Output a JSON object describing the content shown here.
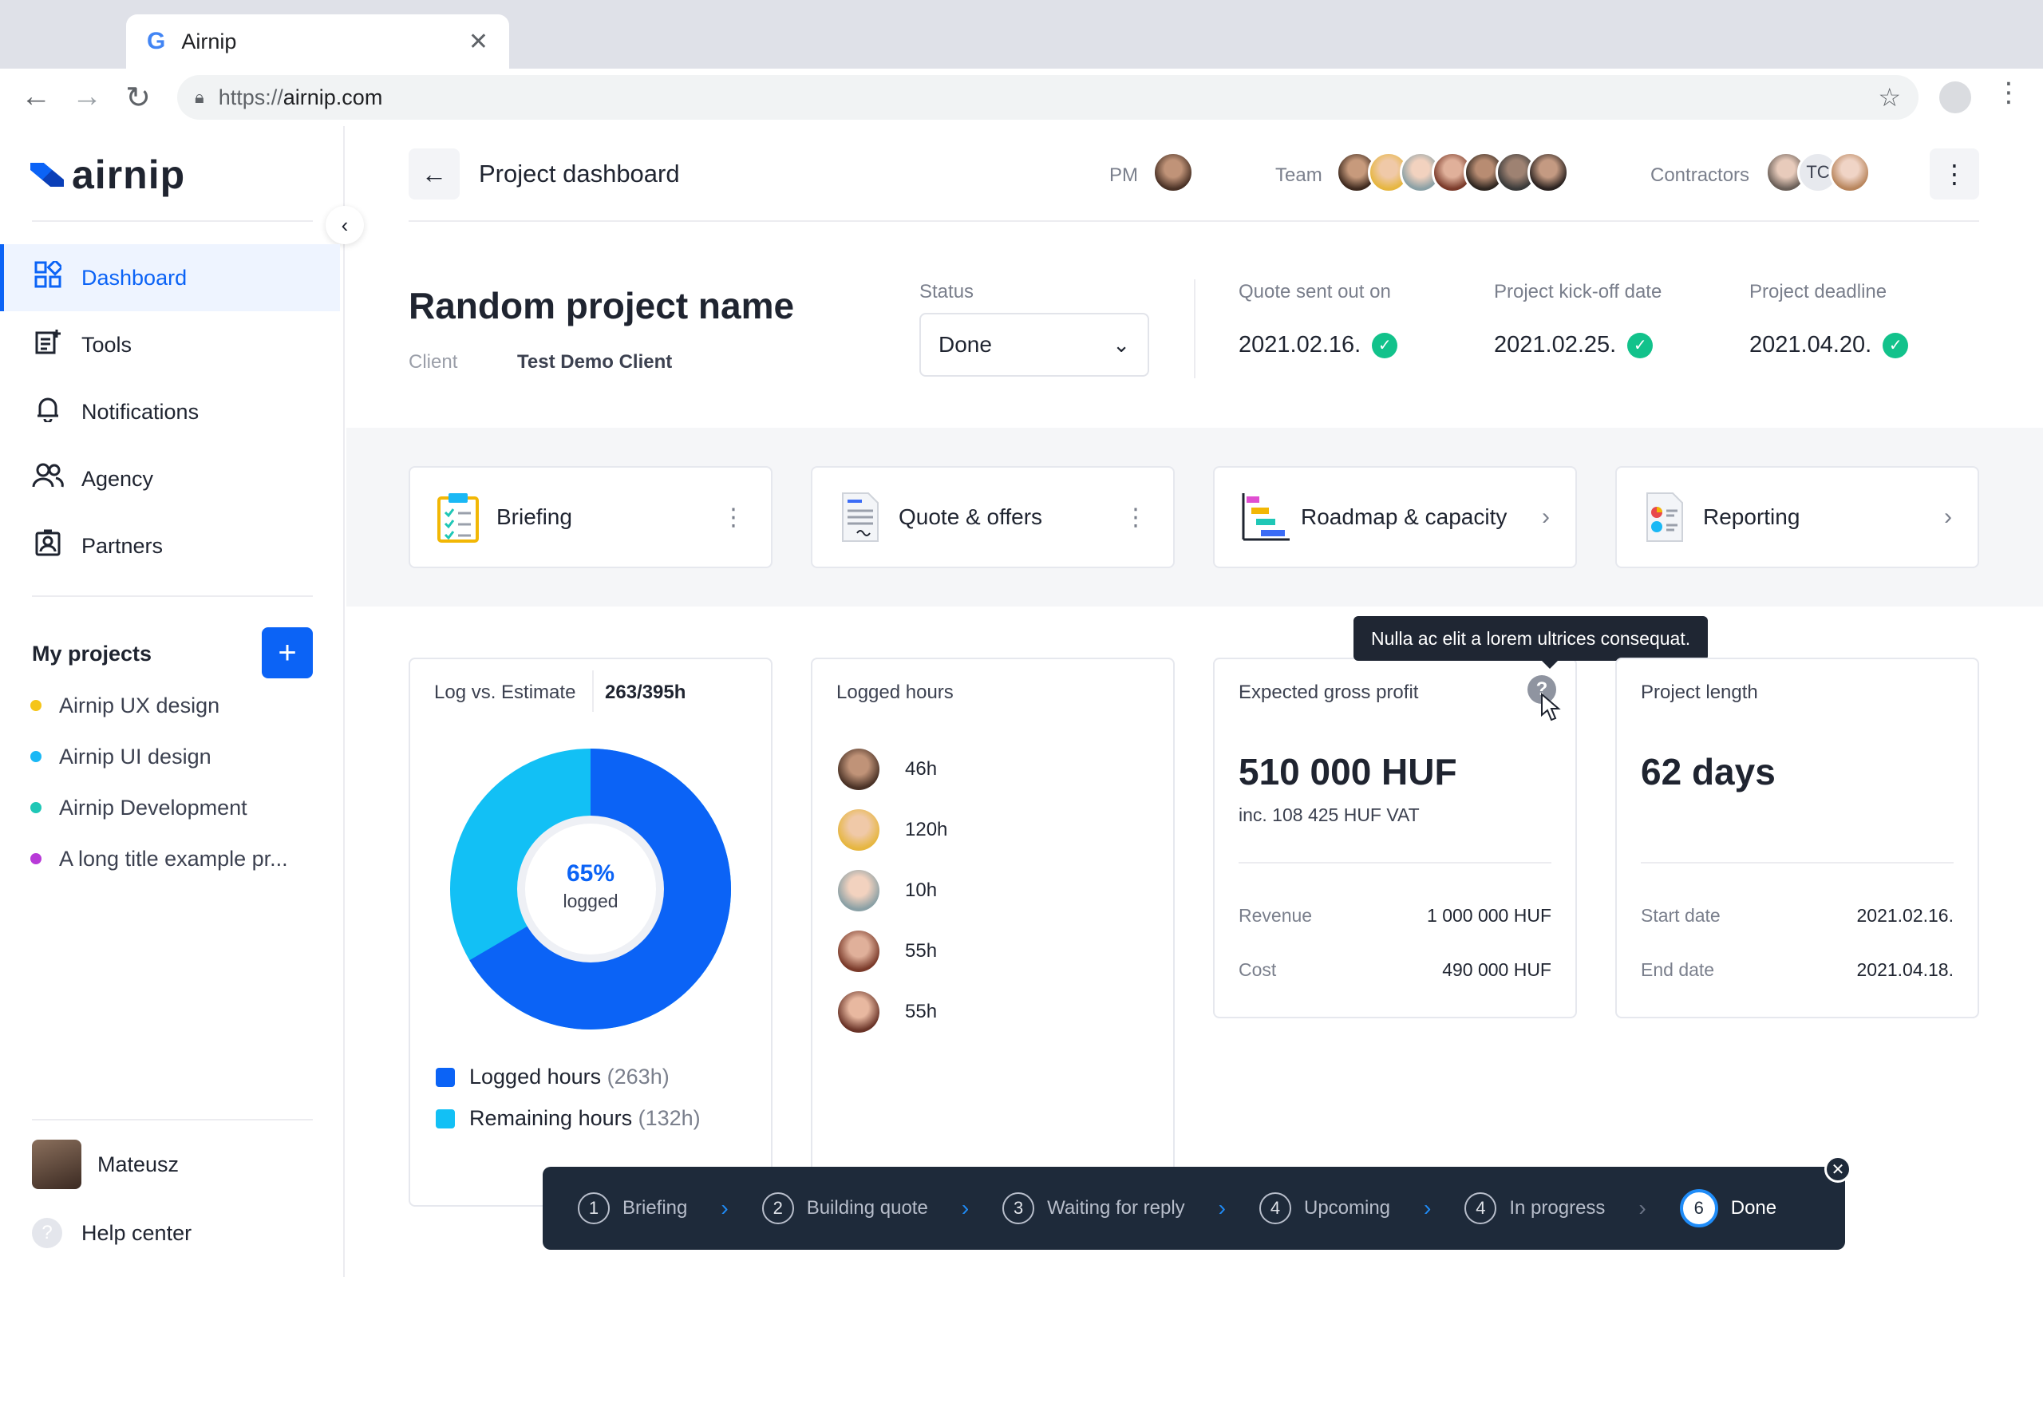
{
  "browser": {
    "tab_title": "Airnip",
    "tab_icon": "G",
    "url_scheme": "https://",
    "url_host": "airnip.com"
  },
  "sidebar": {
    "logo": "airnip",
    "items": [
      {
        "label": "Dashboard",
        "icon": "grid-icon"
      },
      {
        "label": "Tools",
        "icon": "tools-icon"
      },
      {
        "label": "Notifications",
        "icon": "bell-icon"
      },
      {
        "label": "Agency",
        "icon": "people-icon"
      },
      {
        "label": "Partners",
        "icon": "badge-icon"
      }
    ],
    "my_projects_label": "My projects",
    "projects": [
      {
        "name": "Airnip UX design",
        "color": "#f5c518"
      },
      {
        "name": "Airnip UI design",
        "color": "#1ab8f5"
      },
      {
        "name": "Airnip Development",
        "color": "#1fc7b6"
      },
      {
        "name": "A long title example pr...",
        "color": "#b83ad8"
      }
    ],
    "user_name": "Mateusz",
    "help_label": "Help center"
  },
  "header": {
    "title": "Project dashboard",
    "pm_label": "PM",
    "team_label": "Team",
    "contractors_label": "Contractors",
    "contractor_initials": "TC"
  },
  "project": {
    "name": "Random project name",
    "client_label": "Client",
    "client_value": "Test Demo Client",
    "status_label": "Status",
    "status_value": "Done",
    "dates": [
      {
        "label": "Quote sent out on",
        "value": "2021.02.16."
      },
      {
        "label": "Project kick-off date",
        "value": "2021.02.25."
      },
      {
        "label": "Project deadline",
        "value": "2021.04.20."
      }
    ]
  },
  "modules": [
    {
      "label": "Briefing",
      "action": "kebab"
    },
    {
      "label": "Quote & offers",
      "action": "kebab"
    },
    {
      "label": "Roadmap & capacity",
      "action": "chevron"
    },
    {
      "label": "Reporting",
      "action": "chevron"
    }
  ],
  "log_card": {
    "title": "Log vs. Estimate",
    "value": "263/395h",
    "percent_label": "65%",
    "percent_sub": "logged",
    "logged_fraction": 0.665,
    "legend": [
      {
        "label": "Logged hours",
        "value": "(263h)",
        "color": "#0b63f6"
      },
      {
        "label": "Remaining hours",
        "value": "(132h)",
        "color": "#12c0f5"
      }
    ]
  },
  "logged_card": {
    "title": "Logged hours",
    "rows": [
      "46h",
      "120h",
      "10h",
      "55h",
      "55h"
    ]
  },
  "profit_card": {
    "title": "Expected gross profit",
    "value": "510 000 HUF",
    "sub": "inc. 108 425 HUF VAT",
    "revenue_label": "Revenue",
    "revenue_value": "1 000 000 HUF",
    "cost_label": "Cost",
    "cost_value": "490 000 HUF",
    "tooltip": "Nulla ac elit a lorem ultrices consequat."
  },
  "length_card": {
    "title": "Project length",
    "value": "62 days",
    "start_label": "Start date",
    "start_value": "2021.02.16.",
    "end_label": "End date",
    "end_value": "2021.04.18."
  },
  "stepper": [
    {
      "num": "1",
      "label": "Briefing"
    },
    {
      "num": "2",
      "label": "Building quote"
    },
    {
      "num": "3",
      "label": "Waiting for reply"
    },
    {
      "num": "4",
      "label": "Upcoming"
    },
    {
      "num": "4",
      "label": "In progress"
    },
    {
      "num": "6",
      "label": "Done"
    }
  ]
}
